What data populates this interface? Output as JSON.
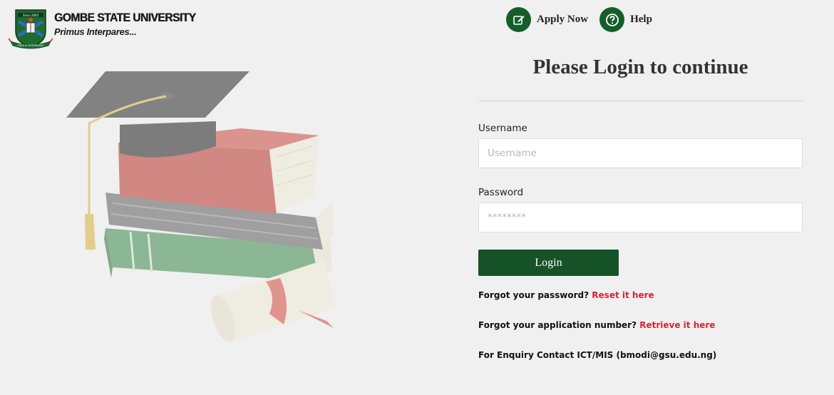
{
  "brand": {
    "name": "GOMBE STATE UNIVERSITY",
    "motto": "Primus Interpares...",
    "crest_top_text": "Since 2005",
    "crest_ribbon_text": "PRIMUS INTERPARES"
  },
  "nav": {
    "apply_label": "Apply Now",
    "help_label": "Help"
  },
  "login": {
    "title": "Please Login to continue",
    "username_label": "Username",
    "username_placeholder": "Username",
    "username_value": "",
    "password_label": "Password",
    "password_placeholder": "********",
    "password_value": "",
    "login_button": "Login"
  },
  "help_links": {
    "forgot_password_text": "Forgot your password?",
    "forgot_password_link": "Reset it here",
    "forgot_appno_text": "Forgot your application number?",
    "forgot_appno_link": "Retrieve it here",
    "enquiry_text": "For Enquiry Contact ICT/MIS (bmodi@gsu.edu.ng)"
  },
  "colors": {
    "primary_green": "#155e2a",
    "button_green": "#155228",
    "link_red": "#d32535",
    "background": "#f0f0f0"
  },
  "icons": {
    "apply": "edit-icon",
    "help": "question-circle-icon"
  }
}
